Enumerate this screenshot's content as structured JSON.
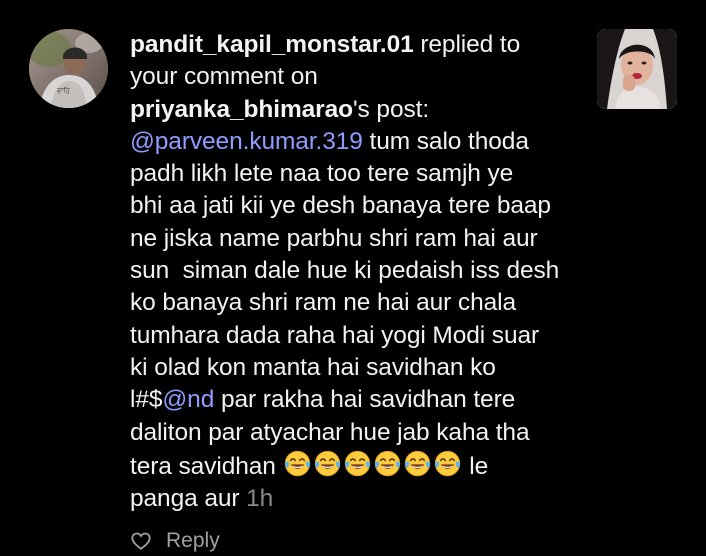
{
  "notification": {
    "actor_username": "pandit_kapil_monstar.01",
    "action_text_1": " replied to",
    "action_text_2": "your comment on",
    "post_owner": "priyanka_bhimarao",
    "post_suffix": "'s post:",
    "mention_1": "@parveen.kumar.319",
    "comment_line_1_rest": " tum salo thoda",
    "comment_lines": [
      "padh likh lete naa too tere samjh ye",
      "bhi aa jati kii ye desh banaya tere baap",
      "ne jiska name parbhu shri ram hai aur",
      "sun  siman dale hue ki pedaish iss desh",
      "ko banaya shri ram ne hai aur chala",
      "tumhara dada raha hai yogi Modi suar",
      "ki olad kon manta hai savidhan ko"
    ],
    "line_mention_prefix": "l#$",
    "mention_2": "@nd",
    "line_mention_rest": " par rakha hai savidhan tere",
    "comment_line_after": "daliton par atyachar hue jab kaha tha",
    "line_emoji_prefix": "tera savidhan ",
    "emoji_count": 6,
    "emoji_name": "face-with-tears-of-joy",
    "line_emoji_suffix": " le",
    "last_line_text": "panga aur ",
    "timestamp": "1h",
    "reply_label": "Reply"
  },
  "colors": {
    "background": "#000000",
    "text": "#f2f2f2",
    "mention": "#8f9cff",
    "timestamp": "#8a8a8a"
  },
  "icons": {
    "like": "heart-outline-icon",
    "emoji": "face-with-tears-of-joy-icon"
  }
}
